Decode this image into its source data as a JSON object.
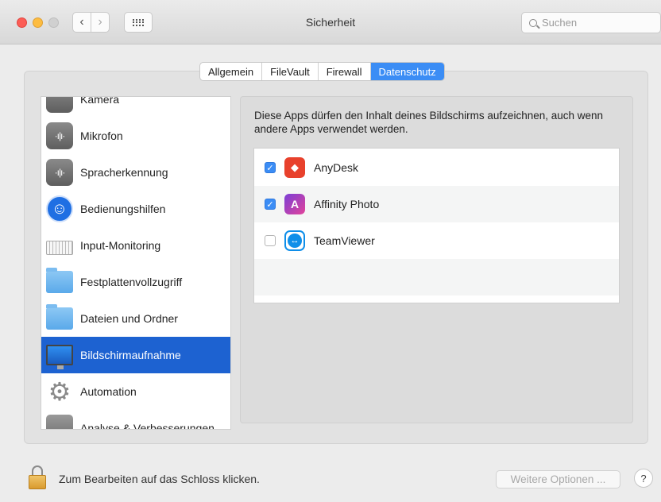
{
  "window": {
    "title": "Sicherheit"
  },
  "search": {
    "placeholder": "Suchen"
  },
  "tabs": [
    {
      "label": "Allgemein",
      "active": false
    },
    {
      "label": "FileVault",
      "active": false
    },
    {
      "label": "Firewall",
      "active": false
    },
    {
      "label": "Datenschutz",
      "active": true
    }
  ],
  "sidebar": {
    "items": [
      {
        "label": "Kamera",
        "icon": "camera-icon"
      },
      {
        "label": "Mikrofon",
        "icon": "microphone-waveform-icon"
      },
      {
        "label": "Spracherkennung",
        "icon": "speech-waveform-icon"
      },
      {
        "label": "Bedienungshilfen",
        "icon": "accessibility-icon"
      },
      {
        "label": "Input-Monitoring",
        "icon": "keyboard-icon"
      },
      {
        "label": "Festplattenvollzugriff",
        "icon": "folder-icon"
      },
      {
        "label": "Dateien und Ordner",
        "icon": "folder-icon"
      },
      {
        "label": "Bildschirmaufnahme",
        "icon": "monitor-icon",
        "selected": true
      },
      {
        "label": "Automation",
        "icon": "gear-icon"
      },
      {
        "label": "Analyse & Verbesserungen",
        "icon": "analytics-icon"
      }
    ]
  },
  "main": {
    "description": "Diese Apps dürfen den Inhalt deines Bildschirms aufzeichnen, auch wenn andere Apps verwendet werden.",
    "apps": [
      {
        "name": "AnyDesk",
        "checked": true,
        "icon": "anydesk-icon"
      },
      {
        "name": "Affinity Photo",
        "checked": true,
        "icon": "affinity-photo-icon"
      },
      {
        "name": "TeamViewer",
        "checked": false,
        "icon": "teamviewer-icon"
      }
    ]
  },
  "footer": {
    "lock_label": "Zum Bearbeiten auf das Schloss klicken.",
    "options_label": "Weitere Optionen ...",
    "help_label": "?"
  },
  "colors": {
    "accent": "#3b8df5",
    "selection": "#1d62d1"
  }
}
